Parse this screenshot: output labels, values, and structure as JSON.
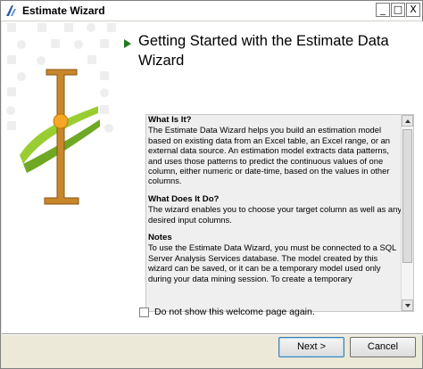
{
  "window": {
    "title": "Estimate Wizard",
    "controls": {
      "minimize": "_",
      "maximize": "□",
      "close": "X"
    }
  },
  "header": {
    "title_line1": "Getting Started with the Estimate Data",
    "title_line2": "Wizard"
  },
  "help": {
    "sections": [
      {
        "heading": "What Is It?",
        "text": "The Estimate Data Wizard helps you build an estimation model based on existing data from an Excel table, an Excel range, or an external data source. An estimation model extracts data patterns, and uses those patterns to predict the continuous values of one column, either numeric or date-time, based on the values in other columns."
      },
      {
        "heading": "What Does It Do?",
        "text": "The wizard enables you to choose your target column as well as any desired input columns."
      },
      {
        "heading": "Notes",
        "text": "To use the Estimate Data Wizard, you must be connected to a SQL Server Analysis Services database. The model created by this wizard can be saved, or it can be a temporary model used only during your data mining session. To create a temporary"
      }
    ]
  },
  "options": {
    "welcome_checkbox_label": "Do not show this welcome page again.",
    "welcome_checkbox_checked": false
  },
  "buttons": {
    "next": "Next >",
    "cancel": "Cancel"
  },
  "colors": {
    "heading_arrow": "#1f7a1f",
    "art_pole": "#c8872b",
    "art_wave": "#9acd32",
    "art_dot": "#f5a623"
  },
  "icons": {
    "app": "estimate-wizard-icon",
    "heading_marker": "triangle-arrow-icon",
    "illustration": "estimate-illustration"
  }
}
